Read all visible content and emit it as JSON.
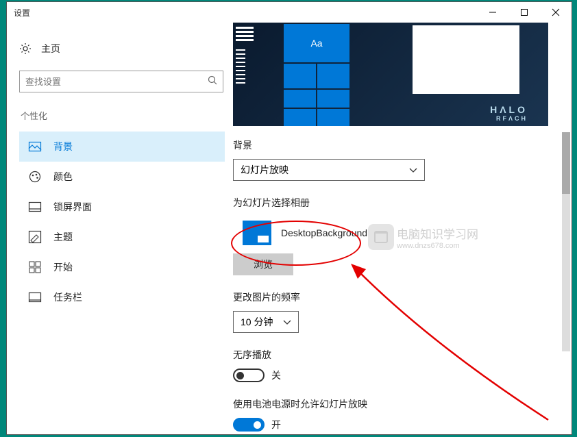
{
  "window": {
    "title": "设置"
  },
  "titlebar": {
    "minimize": "—",
    "maximize": "☐",
    "close": "✕"
  },
  "home": {
    "label": "主页"
  },
  "search": {
    "placeholder": "查找设置"
  },
  "category": "个性化",
  "nav": [
    {
      "label": "背景",
      "icon": "picture-icon",
      "active": true
    },
    {
      "label": "颜色",
      "icon": "color-icon",
      "active": false
    },
    {
      "label": "锁屏界面",
      "icon": "lock-screen-icon",
      "active": false
    },
    {
      "label": "主题",
      "icon": "theme-icon",
      "active": false
    },
    {
      "label": "开始",
      "icon": "start-icon",
      "active": false
    },
    {
      "label": "任务栏",
      "icon": "taskbar-icon",
      "active": false
    }
  ],
  "preview": {
    "tile_text": "Aa",
    "brand": "HΛLO",
    "brand_sub": "RFΛCH"
  },
  "main": {
    "background_label": "背景",
    "background_value": "幻灯片放映",
    "album_label": "为幻灯片选择相册",
    "album_name": "DesktopBackground",
    "browse_label": "浏览",
    "freq_label": "更改图片的频率",
    "freq_value": "10 分钟",
    "shuffle_label": "无序播放",
    "shuffle_state": "关",
    "battery_label": "使用电池电源时允许幻灯片放映",
    "battery_state": "开"
  },
  "watermark": {
    "text": "电脑知识学习网",
    "url": "www.dnzs678.com"
  }
}
